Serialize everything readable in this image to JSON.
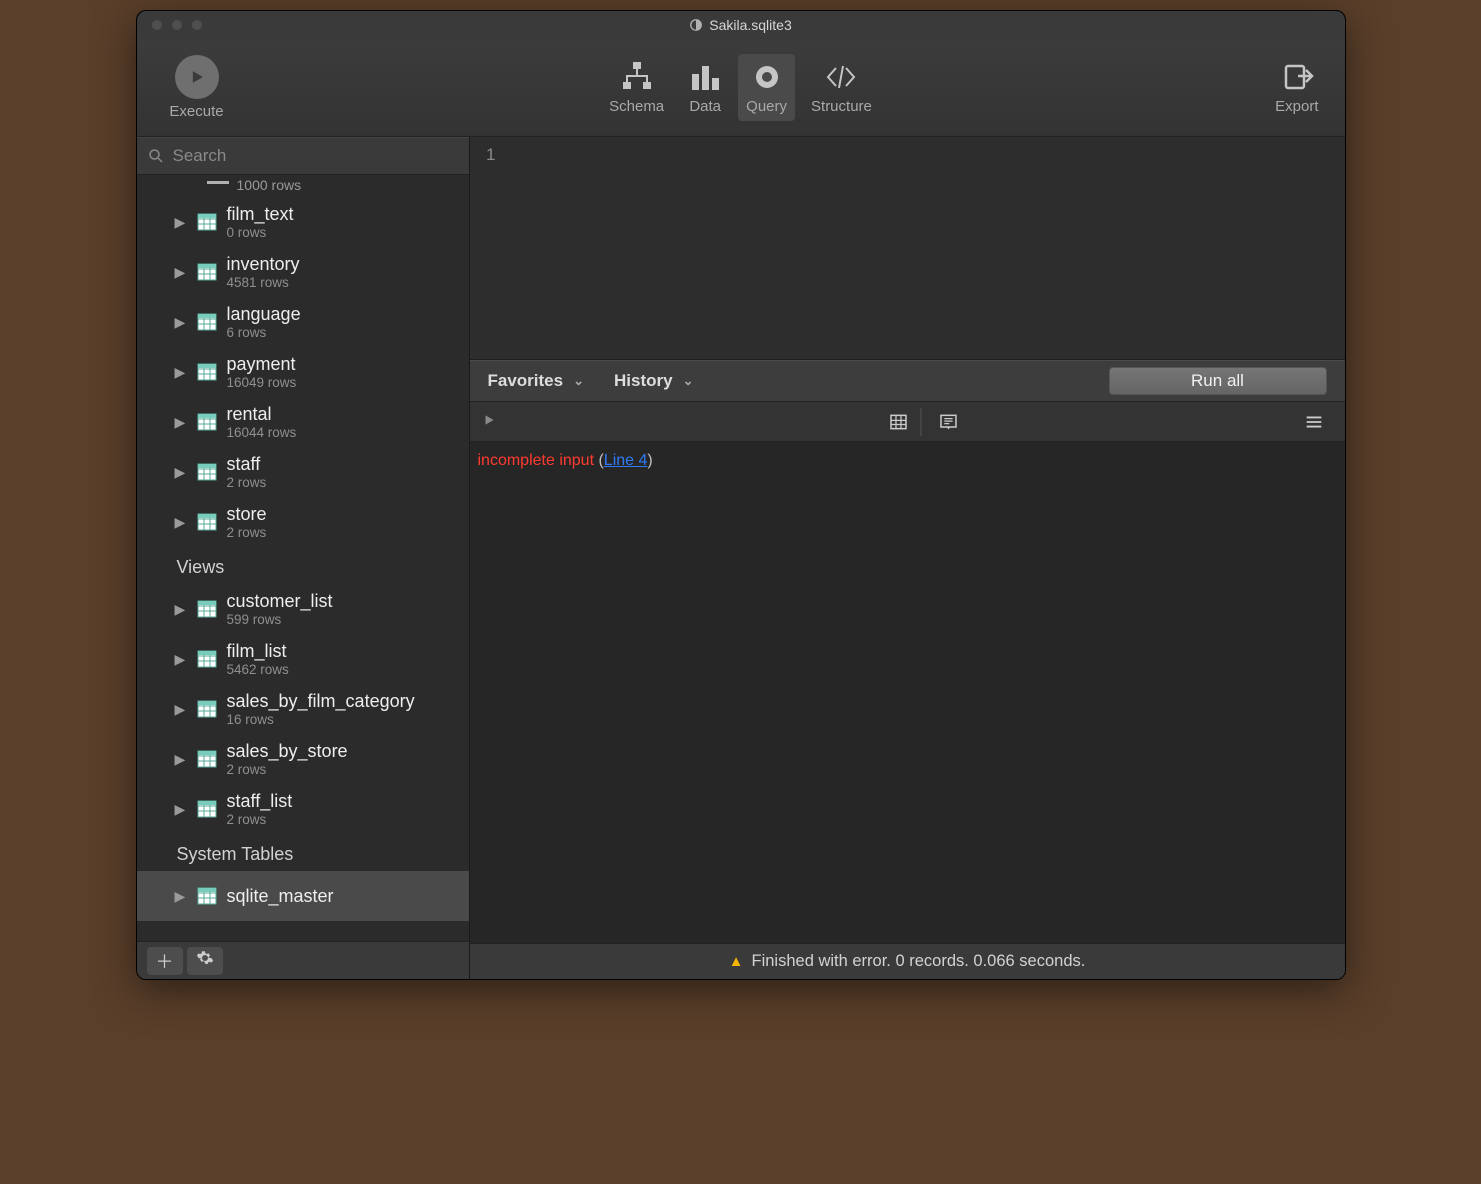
{
  "window": {
    "title": "Sakila.sqlite3"
  },
  "toolbar": {
    "execute_label": "Execute",
    "schema_label": "Schema",
    "data_label": "Data",
    "query_label": "Query",
    "structure_label": "Structure",
    "export_label": "Export"
  },
  "sidebar": {
    "search_placeholder": "Search",
    "partial_first_sub": "1000 rows",
    "tables": [
      {
        "name": "film_text",
        "sub": "0 rows"
      },
      {
        "name": "inventory",
        "sub": "4581 rows"
      },
      {
        "name": "language",
        "sub": "6 rows"
      },
      {
        "name": "payment",
        "sub": "16049 rows"
      },
      {
        "name": "rental",
        "sub": "16044 rows"
      },
      {
        "name": "staff",
        "sub": "2 rows"
      },
      {
        "name": "store",
        "sub": "2 rows"
      }
    ],
    "views_label": "Views",
    "views": [
      {
        "name": "customer_list",
        "sub": "599 rows"
      },
      {
        "name": "film_list",
        "sub": "5462 rows"
      },
      {
        "name": "sales_by_film_category",
        "sub": "16 rows"
      },
      {
        "name": "sales_by_store",
        "sub": "2 rows"
      },
      {
        "name": "staff_list",
        "sub": "2 rows"
      }
    ],
    "system_label": "System Tables",
    "system": [
      {
        "name": "sqlite_master",
        "sub": ""
      }
    ]
  },
  "editor": {
    "line_number": "1"
  },
  "favbar": {
    "favorites": "Favorites",
    "history": "History",
    "runall": "Run all"
  },
  "error": {
    "message": "incomplete input",
    "paren_open": " (",
    "link": "Line 4",
    "paren_close": ")"
  },
  "status": {
    "text": "Finished with error. 0 records. 0.066 seconds."
  }
}
